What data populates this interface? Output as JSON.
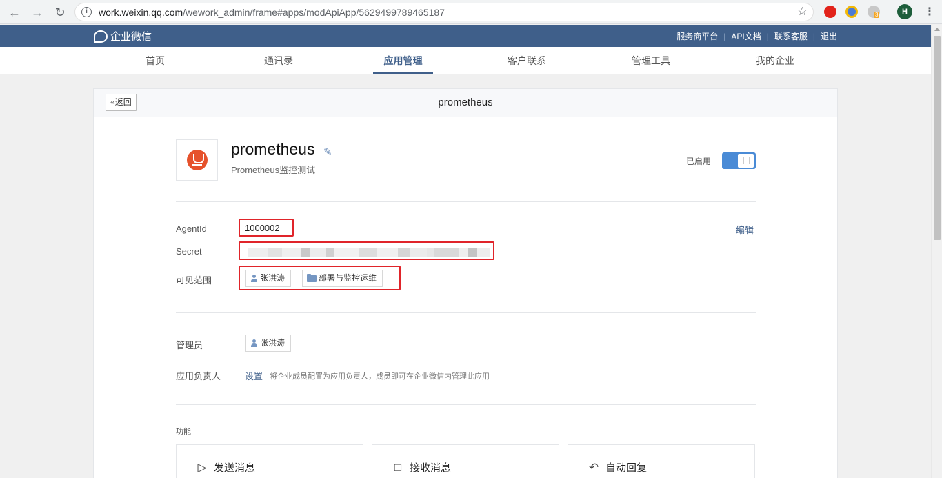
{
  "browser": {
    "url_host": "work.weixin.qq.com",
    "url_path": "/wework_admin/frame#apps/modApiApp/5629499789465187",
    "profile_initial": "H",
    "extension_badge": "3"
  },
  "header": {
    "logo_text": "企业微信",
    "links": [
      "服务商平台",
      "API文档",
      "联系客服",
      "退出"
    ]
  },
  "nav": {
    "items": [
      "首页",
      "通讯录",
      "应用管理",
      "客户联系",
      "管理工具",
      "我的企业"
    ],
    "active": "应用管理"
  },
  "card": {
    "back_label": "返回",
    "title": "prometheus"
  },
  "app": {
    "name": "prometheus",
    "description": "Prometheus监控测试",
    "status_label": "已启用",
    "enabled": true
  },
  "details": {
    "agentid_label": "AgentId",
    "agentid_value": "1000002",
    "edit_label": "编辑",
    "secret_label": "Secret",
    "visible_label": "可见范围",
    "visible_tags": [
      "张洪涛",
      "部署与监控运维"
    ],
    "admin_label": "管理员",
    "admin_tags": [
      "张洪涛"
    ],
    "owner_label": "应用负责人",
    "owner_set_link": "设置",
    "owner_hint": "将企业成员配置为应用负责人，成员即可在企业微信内管理此应用"
  },
  "functions": {
    "label": "功能",
    "cards": [
      {
        "label": "发送消息",
        "icon": "send-icon"
      },
      {
        "label": "接收消息",
        "icon": "chat-icon"
      },
      {
        "label": "自动回复",
        "icon": "reply-icon"
      }
    ]
  },
  "colors": {
    "brand_blue": "#3f5f8a",
    "toggle_on": "#4a8bd6",
    "highlight_red": "#e0242a",
    "prometheus_orange": "#e6522c"
  }
}
